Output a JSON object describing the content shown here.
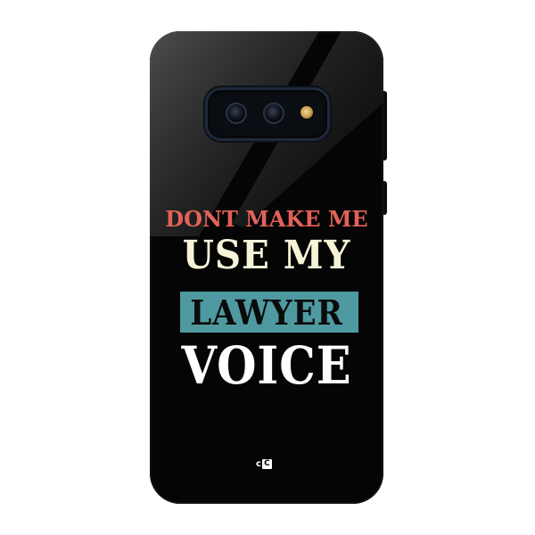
{
  "product": {
    "case_color": "#050505",
    "camera_ring_color": "#1e2a3a"
  },
  "slogan": {
    "line_1": "DONT MAKE ME",
    "line_2": "USE MY",
    "line_3": "LAWYER",
    "line_4": "VOICE",
    "colors": {
      "line_1": "#e2625a",
      "line_2": "#f6f3d8",
      "band": "#4f9aa1",
      "line_3": "#0b0b0b",
      "line_4": "#ffffff"
    }
  },
  "brand": {
    "logo_text_left": "c",
    "logo_text_right": "C"
  }
}
